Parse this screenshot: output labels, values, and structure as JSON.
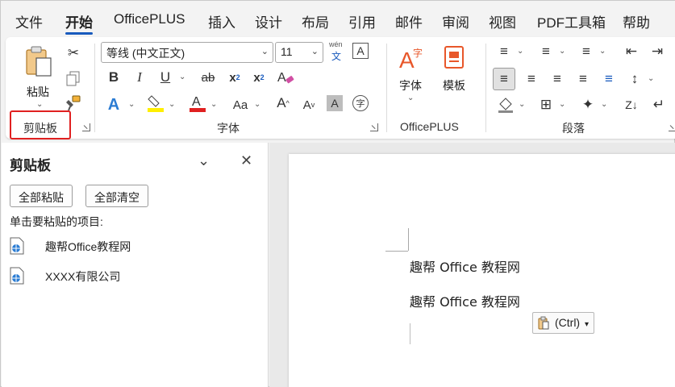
{
  "tabs": [
    "文件",
    "开始",
    "OfficePLUS",
    "插入",
    "设计",
    "布局",
    "引用",
    "邮件",
    "审阅",
    "视图",
    "PDF工具箱",
    "帮助"
  ],
  "active_tab": "开始",
  "ribbon": {
    "clipboard": {
      "paste_label": "粘贴",
      "group_label": "剪贴板"
    },
    "font": {
      "font_name": "等线 (中文正文)",
      "font_size": "11",
      "phonetic_label_top": "wén",
      "phonetic_label_bottom": "文",
      "group_label": "字体"
    },
    "officeplus": {
      "font_label": "字体",
      "template_label": "模板",
      "group_label": "OfficePLUS"
    },
    "paragraph": {
      "group_label": "段落"
    }
  },
  "pane": {
    "title": "剪贴板",
    "paste_all": "全部粘贴",
    "clear_all": "全部清空",
    "hint": "单击要粘贴的项目:",
    "items": [
      "趣帮Office教程网",
      "XXXX有限公司"
    ]
  },
  "document": {
    "lines": [
      "趣帮 Office 教程网",
      "趣帮 Office 教程网"
    ],
    "paste_options": "(Ctrl)"
  },
  "colors": {
    "accent": "#185abd",
    "highlight_box": "#e02020",
    "font_color_red": "#e02020",
    "highlight_yellow": "#ffef00",
    "officeplus_orange": "#e8572a"
  }
}
